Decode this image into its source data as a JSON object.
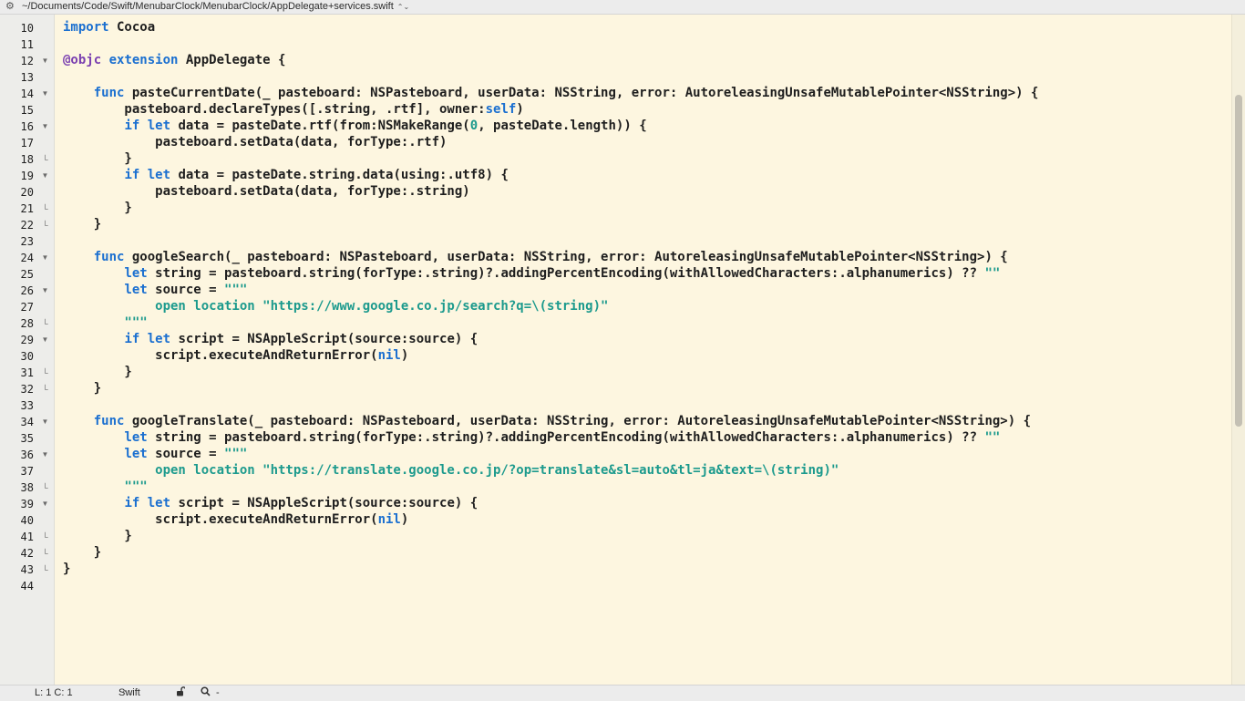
{
  "title_bar": {
    "settings_icon": "gear-icon",
    "path": "~/Documents/Code/Swift/MenubarClock/MenubarClock/AppDelegate+services.swift",
    "chevron": "⌃⌄"
  },
  "editor": {
    "lines": [
      {
        "n": "10",
        "fold": "",
        "html": "<span class=\"kw\">import</span> Cocoa"
      },
      {
        "n": "11",
        "fold": "",
        "html": ""
      },
      {
        "n": "12",
        "fold": "open",
        "html": "<span class=\"at\">@objc</span> <span class=\"kw\">extension</span> AppDelegate {"
      },
      {
        "n": "13",
        "fold": "",
        "html": ""
      },
      {
        "n": "14",
        "fold": "open",
        "html": "    <span class=\"kw\">func</span> pasteCurrentDate(_ pasteboard: NSPasteboard, userData: NSString, error: AutoreleasingUnsafeMutablePointer&lt;NSString&gt;) {"
      },
      {
        "n": "15",
        "fold": "",
        "html": "        pasteboard.declareTypes([.string, .rtf], owner:<span class=\"kw\">self</span>)"
      },
      {
        "n": "16",
        "fold": "open",
        "html": "        <span class=\"kw\">if let</span> data = pasteDate.rtf(from:NSMakeRange(<span class=\"num\">0</span>, pasteDate.length)) {"
      },
      {
        "n": "17",
        "fold": "",
        "html": "            pasteboard.setData(data, forType:.rtf)"
      },
      {
        "n": "18",
        "fold": "end",
        "html": "        }"
      },
      {
        "n": "19",
        "fold": "open",
        "html": "        <span class=\"kw\">if let</span> data = pasteDate.string.data(using:.utf8) {"
      },
      {
        "n": "20",
        "fold": "",
        "html": "            pasteboard.setData(data, forType:.string)"
      },
      {
        "n": "21",
        "fold": "end",
        "html": "        }"
      },
      {
        "n": "22",
        "fold": "end",
        "html": "    }"
      },
      {
        "n": "23",
        "fold": "",
        "html": ""
      },
      {
        "n": "24",
        "fold": "open",
        "html": "    <span class=\"kw\">func</span> googleSearch(_ pasteboard: NSPasteboard, userData: NSString, error: AutoreleasingUnsafeMutablePointer&lt;NSString&gt;) {"
      },
      {
        "n": "25",
        "fold": "",
        "html": "        <span class=\"kw\">let</span> string = pasteboard.string(forType:.string)?.addingPercentEncoding(withAllowedCharacters:.alphanumerics) ?? <span class=\"str\">\"\"</span>"
      },
      {
        "n": "26",
        "fold": "open",
        "html": "        <span class=\"kw\">let</span> source = <span class=\"str\">\"\"\"</span>"
      },
      {
        "n": "27",
        "fold": "",
        "html": "<span class=\"str\">            open location \"https://www.google.co.jp/search?q=\\(string)\"</span>"
      },
      {
        "n": "28",
        "fold": "end",
        "html": "<span class=\"str\">        \"\"\"</span>"
      },
      {
        "n": "29",
        "fold": "open",
        "html": "        <span class=\"kw\">if let</span> script = NSAppleScript(source:source) {"
      },
      {
        "n": "30",
        "fold": "",
        "html": "            script.executeAndReturnError(<span class=\"nil\">nil</span>)"
      },
      {
        "n": "31",
        "fold": "end",
        "html": "        }"
      },
      {
        "n": "32",
        "fold": "end",
        "html": "    }"
      },
      {
        "n": "33",
        "fold": "",
        "html": ""
      },
      {
        "n": "34",
        "fold": "open",
        "html": "    <span class=\"kw\">func</span> googleTranslate(_ pasteboard: NSPasteboard, userData: NSString, error: AutoreleasingUnsafeMutablePointer&lt;NSString&gt;) {"
      },
      {
        "n": "35",
        "fold": "",
        "html": "        <span class=\"kw\">let</span> string = pasteboard.string(forType:.string)?.addingPercentEncoding(withAllowedCharacters:.alphanumerics) ?? <span class=\"str\">\"\"</span>"
      },
      {
        "n": "36",
        "fold": "open",
        "html": "        <span class=\"kw\">let</span> source = <span class=\"str\">\"\"\"</span>"
      },
      {
        "n": "37",
        "fold": "",
        "html": "<span class=\"str\">            open location \"https://translate.google.co.jp/?op=translate&amp;sl=auto&amp;tl=ja&amp;text=\\(string)\"</span>"
      },
      {
        "n": "38",
        "fold": "end",
        "html": "<span class=\"str\">        \"\"\"</span>"
      },
      {
        "n": "39",
        "fold": "open",
        "html": "        <span class=\"kw\">if let</span> script = NSAppleScript(source:source) {"
      },
      {
        "n": "40",
        "fold": "",
        "html": "            script.executeAndReturnError(<span class=\"nil\">nil</span>)"
      },
      {
        "n": "41",
        "fold": "end",
        "html": "        }"
      },
      {
        "n": "42",
        "fold": "end",
        "html": "    }"
      },
      {
        "n": "43",
        "fold": "end",
        "html": "}"
      },
      {
        "n": "44",
        "fold": "",
        "html": ""
      }
    ]
  },
  "status_bar": {
    "cursor_position": "L: 1 C: 1",
    "language": "Swift",
    "language_chevron": "⌃⌄",
    "lock_icon": "lock-icon",
    "search_icon": "search-icon",
    "search_value": "-"
  },
  "colors": {
    "background": "#fdf6e0",
    "keyword": "#1a6fd0",
    "attribute": "#7a3fb0",
    "string": "#1c9a8d"
  }
}
